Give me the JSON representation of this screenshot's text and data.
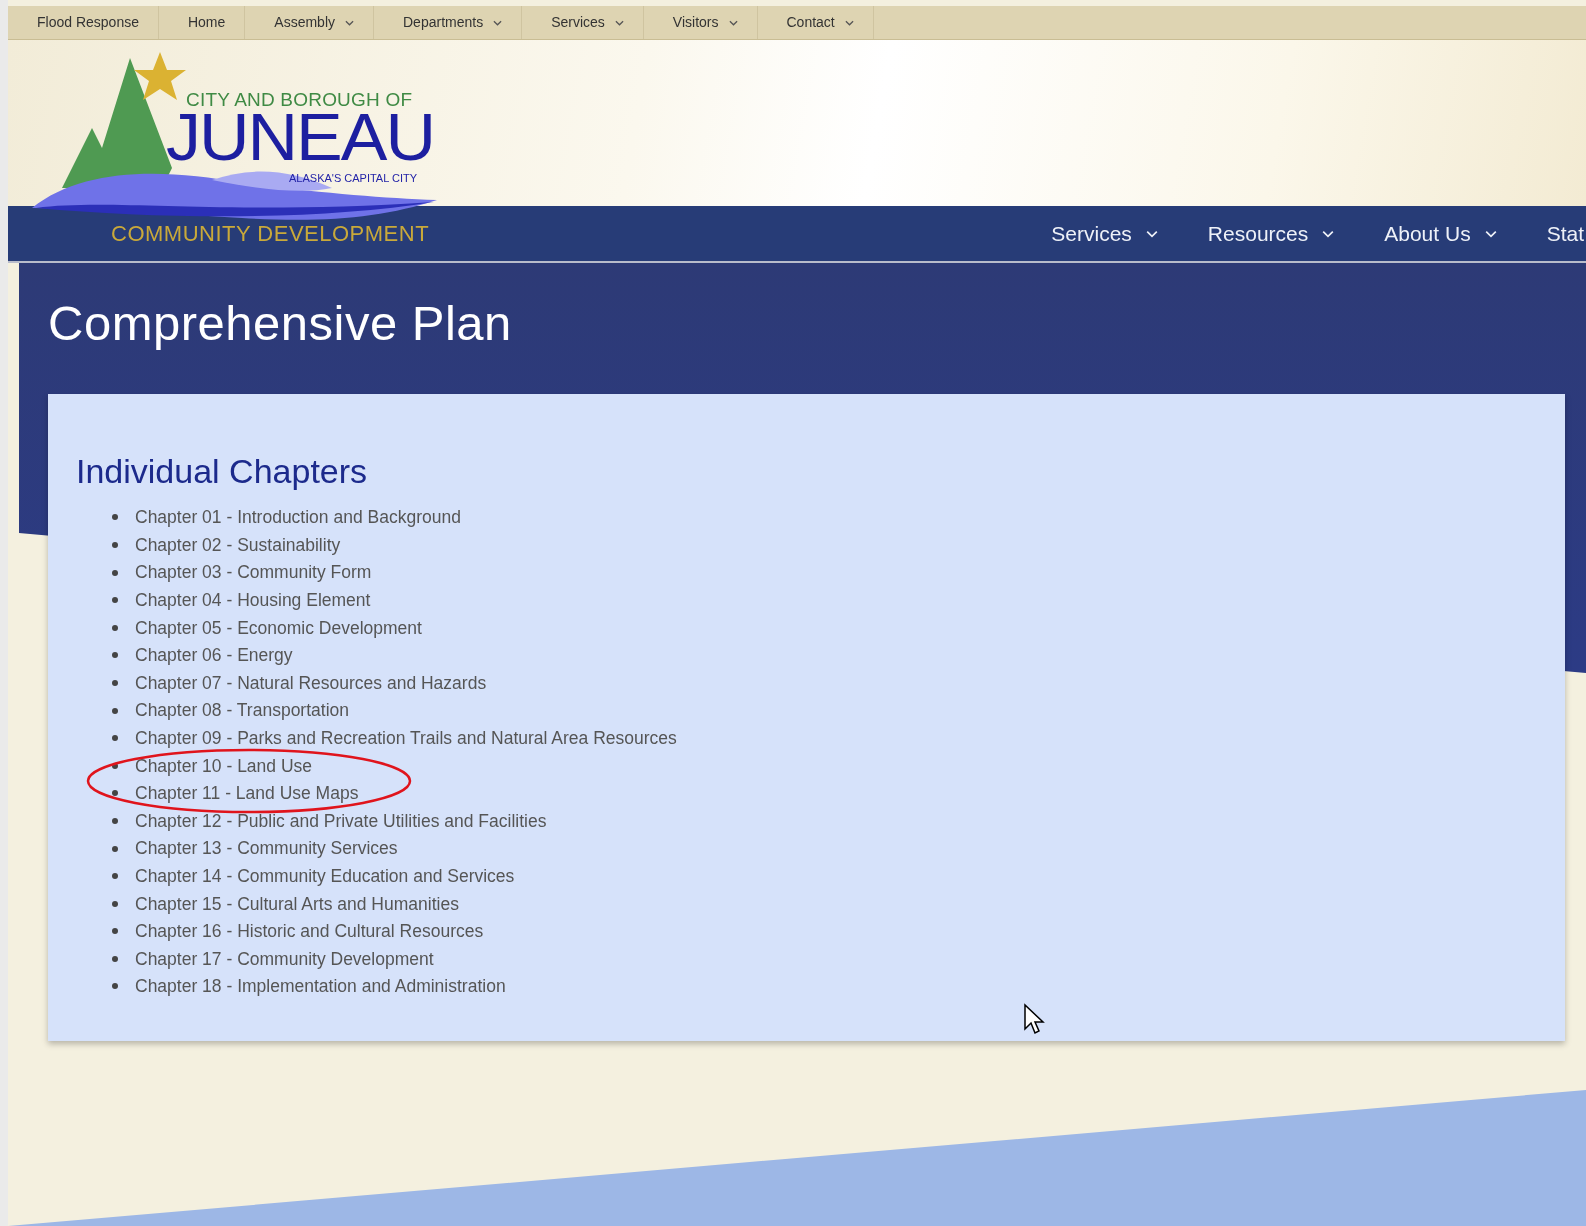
{
  "top_nav": [
    {
      "label": "Flood Response",
      "has_dropdown": false
    },
    {
      "label": "Home",
      "has_dropdown": false
    },
    {
      "label": "Assembly",
      "has_dropdown": true
    },
    {
      "label": "Departments",
      "has_dropdown": true
    },
    {
      "label": "Services",
      "has_dropdown": true
    },
    {
      "label": "Visitors",
      "has_dropdown": true
    },
    {
      "label": "Contact",
      "has_dropdown": true
    }
  ],
  "logo": {
    "line_1": "CITY AND BOROUGH OF",
    "name": "JUNEAU",
    "tagline": "ALASKA'S CAPITAL CITY",
    "department": "COMMUNITY DEVELOPMENT"
  },
  "main_nav": [
    {
      "label": "Services",
      "has_dropdown": true
    },
    {
      "label": "Resources",
      "has_dropdown": true
    },
    {
      "label": "About Us",
      "has_dropdown": true
    },
    {
      "label": "Stat",
      "has_dropdown": false
    }
  ],
  "page_title": "Comprehensive Plan",
  "section": {
    "heading": "Individual Chapters",
    "chapters": [
      "Chapter 01 - Introduction and Background",
      "Chapter 02 - Sustainability",
      "Chapter 03 - Community Form",
      "Chapter 04 - Housing Element",
      "Chapter 05 - Economic Development",
      "Chapter 06 - Energy",
      "Chapter 07 - Natural Resources and Hazards",
      "Chapter 08 - Transportation",
      "Chapter 09 - Parks and Recreation Trails and Natural Area Resources",
      "Chapter 10 - Land Use",
      "Chapter 11 - Land Use Maps",
      "Chapter 12 - Public and Private Utilities and Facilities",
      "Chapter 13 - Community Services",
      "Chapter 14 - Community Education and Services",
      "Chapter 15 - Cultural Arts and Humanities",
      "Chapter 16 - Historic and Cultural Resources",
      "Chapter 17 - Community Development",
      "Chapter 18 - Implementation and Administration"
    ]
  }
}
